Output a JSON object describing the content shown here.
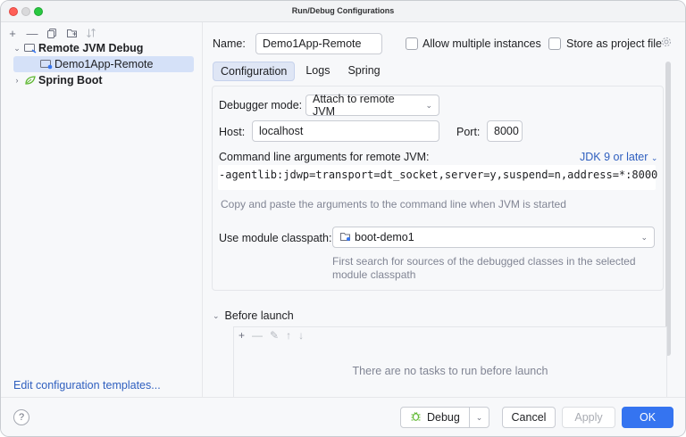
{
  "window": {
    "title": "Run/Debug Configurations"
  },
  "left": {
    "tree": [
      {
        "label": "Remote JVM Debug",
        "expanded": true,
        "icon": "remote-debug-icon"
      },
      {
        "label": "Demo1App-Remote",
        "selected": true,
        "icon": "remote-config-icon"
      },
      {
        "label": "Spring Boot",
        "expanded": false,
        "icon": "spring-boot-icon"
      }
    ],
    "edit_templates": "Edit configuration templates..."
  },
  "form": {
    "name_label": "Name:",
    "name_value": "Demo1App-Remote",
    "allow_multiple": "Allow multiple instances",
    "store_as_project": "Store as project file",
    "tabs": [
      "Configuration",
      "Logs",
      "Spring"
    ],
    "debugger_mode_label": "Debugger mode:",
    "debugger_mode_value": "Attach to remote JVM",
    "host_label": "Host:",
    "host_value": "localhost",
    "port_label": "Port:",
    "port_value": "8000",
    "cmd_label": "Command line arguments for remote JVM:",
    "jdk_link": "JDK 9 or later",
    "cmd_value": "-agentlib:jdwp=transport=dt_socket,server=y,suspend=n,address=*:8000",
    "cmd_hint": "Copy and paste the arguments to the command line when JVM is started",
    "module_label": "Use module classpath:",
    "module_value": "boot-demo1",
    "module_hint_1": "First search for sources of the debugged classes in the selected",
    "module_hint_2": "module classpath",
    "before_launch": "Before launch",
    "before_launch_empty": "There are no tasks to run before launch"
  },
  "footer": {
    "help": "?",
    "debug": "Debug",
    "cancel": "Cancel",
    "apply": "Apply",
    "ok": "OK"
  },
  "colors": {
    "accent": "#3574f0",
    "selection": "#d5e1f8",
    "link": "#2f5fbf"
  }
}
